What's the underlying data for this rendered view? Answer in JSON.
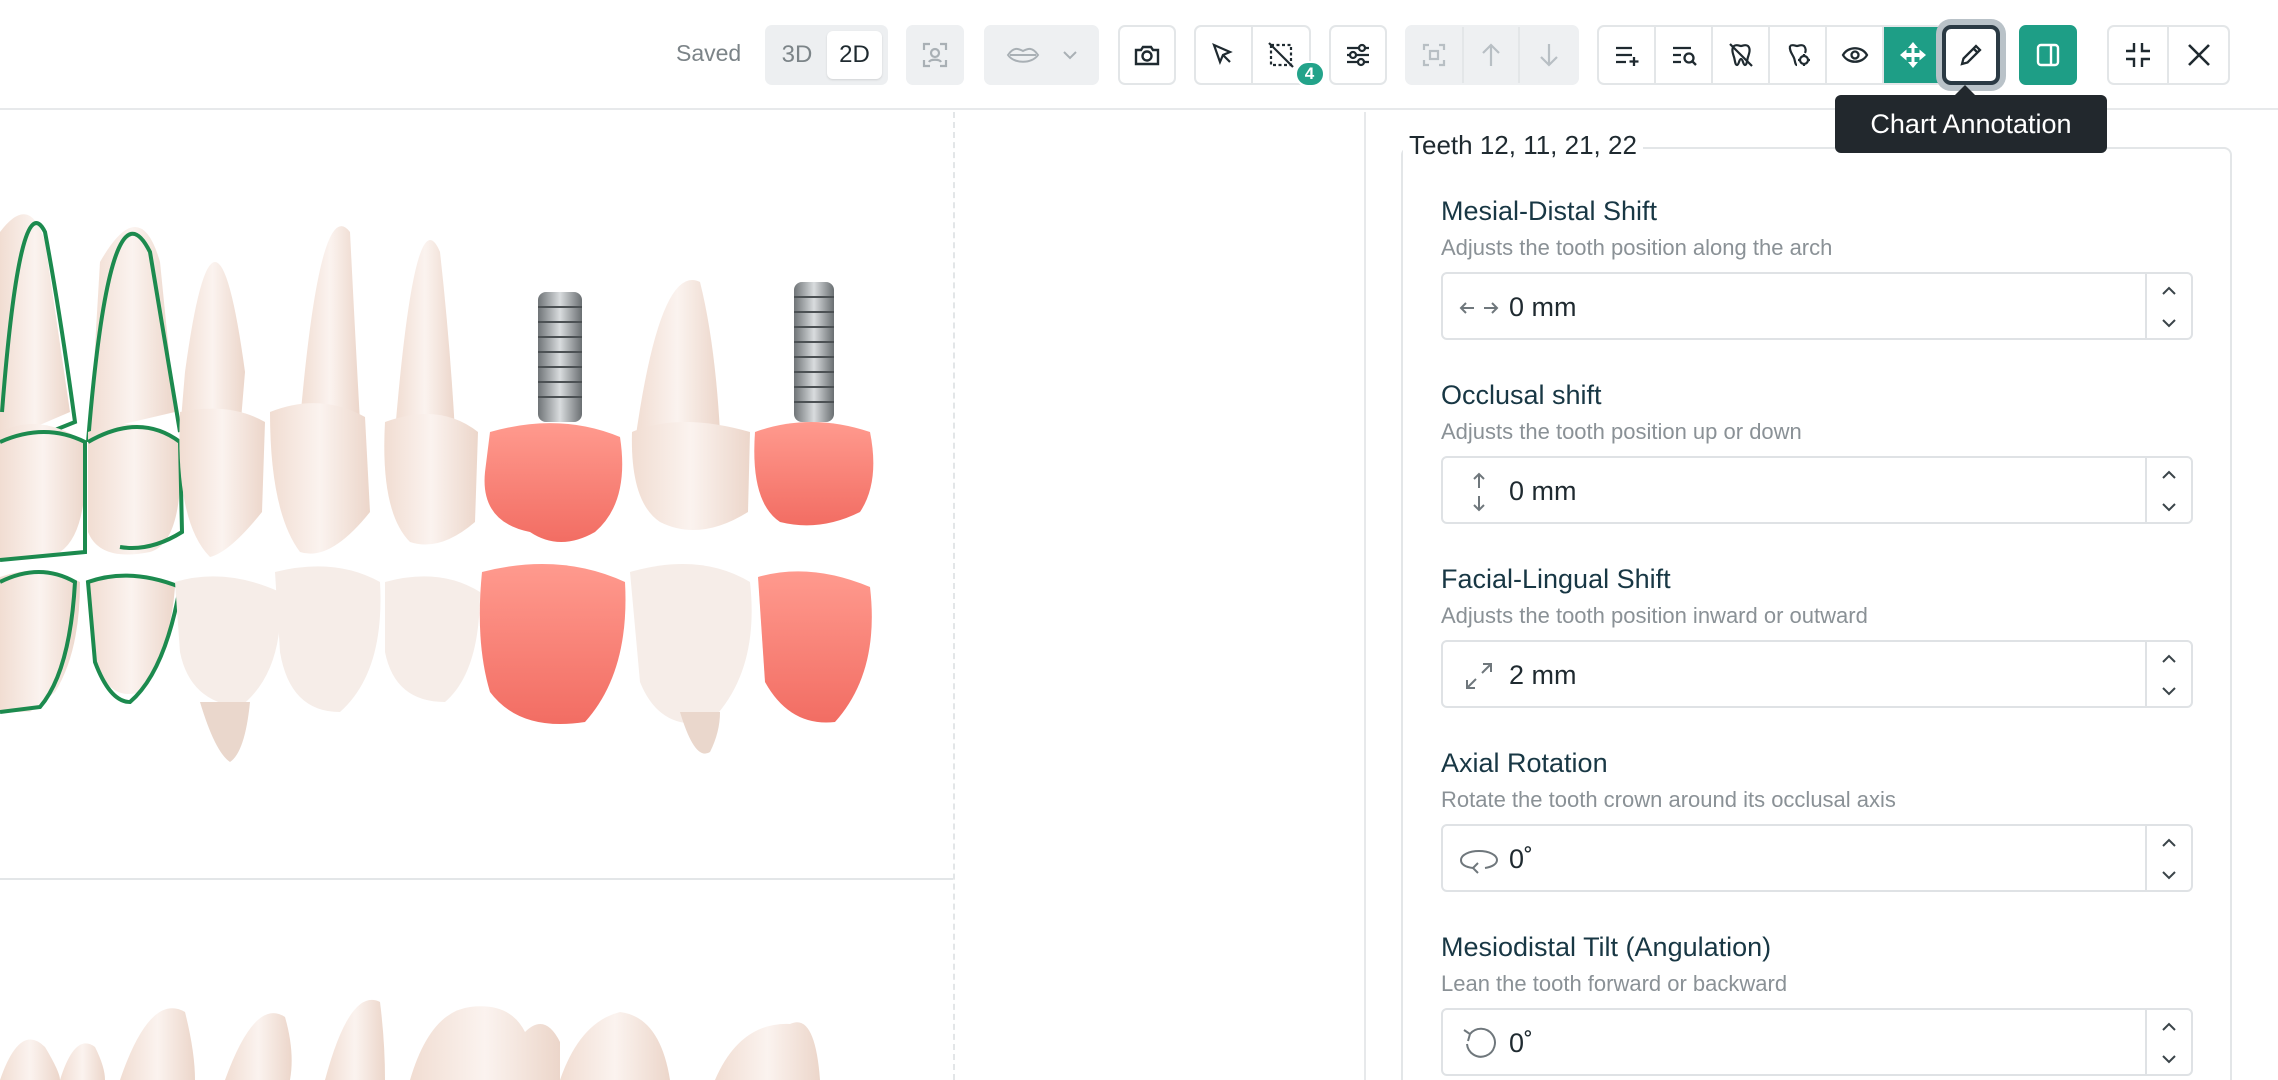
{
  "toolbar": {
    "status": "Saved",
    "view_modes": [
      "3D",
      "2D"
    ],
    "active_view_mode": "2D",
    "selection_count": "4",
    "tooltip": "Chart Annotation",
    "accent_color": "#1e9e86"
  },
  "panel": {
    "group_title": "Teeth 12, 11, 21, 22",
    "properties": [
      {
        "title": "Mesial-Distal Shift",
        "description": "Adjusts the tooth position along the arch",
        "value": "0 mm",
        "icon": "horizontal-arrows-icon"
      },
      {
        "title": "Occlusal shift",
        "description": "Adjusts the tooth position up or down",
        "value": "0 mm",
        "icon": "vertical-arrows-icon"
      },
      {
        "title": "Facial-Lingual Shift",
        "description": "Adjusts the tooth position inward or outward",
        "value": "2 mm",
        "icon": "diagonal-arrows-icon"
      },
      {
        "title": "Axial Rotation",
        "description": "Rotate the tooth crown around its occlusal axis",
        "value": "0˚",
        "icon": "axial-rotation-icon"
      },
      {
        "title": "Mesiodistal Tilt (Angulation)",
        "description": "Lean the tooth forward or backward",
        "value": "0˚",
        "icon": "tilt-rotation-icon"
      }
    ]
  }
}
